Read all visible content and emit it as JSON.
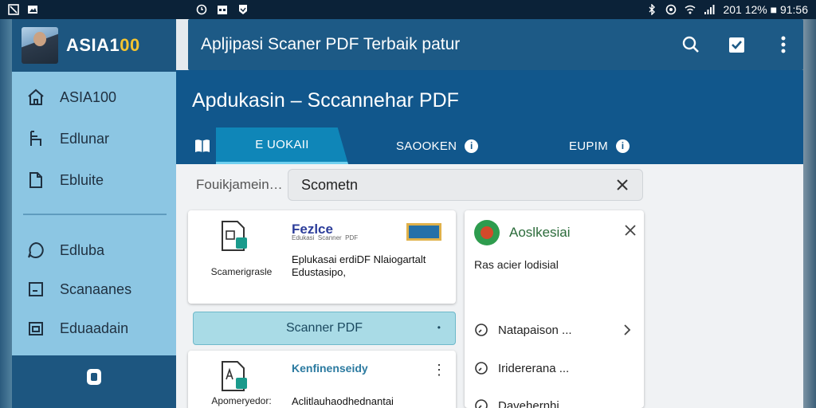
{
  "status_bar": {
    "right_text": "201 12% ■ 91:56"
  },
  "app_bar": {
    "title": "Apljipasi Scaner PDF Terbaik patur"
  },
  "sidebar": {
    "brand_prefix": "ASIA1",
    "brand_accent": "00",
    "items": [
      {
        "label": "ASIA100",
        "icon": "house-icon"
      },
      {
        "label": "Edlunar",
        "icon": "chair-icon"
      },
      {
        "label": "Ebluite",
        "icon": "document-icon"
      },
      {
        "label": "Edluba",
        "icon": "chat-icon"
      },
      {
        "label": "Scanaanes",
        "icon": "scanner-icon"
      },
      {
        "label": "Eduaadain",
        "icon": "image-icon"
      }
    ]
  },
  "header": {
    "title": "Apdukasin – Sccannehar PDF",
    "tabs": [
      {
        "label": "E   UOKAII",
        "active": true
      },
      {
        "label": "SAOOKEN",
        "active": false
      },
      {
        "label": "EUPIM",
        "active": false
      }
    ]
  },
  "filter": {
    "label": "Fouikjamein…",
    "search_value": "Scometn"
  },
  "card1": {
    "doc_label": "Scamerigrasle",
    "brand": "Fezlce",
    "brand_sub": "Edukasi  Scanner  PDF",
    "description": "Eplukasai erdiDF Nlaiogartalt Edustasipo,"
  },
  "scanner_button": {
    "label": "Scanner PDF"
  },
  "card2": {
    "doc_label": "Apomeryedor:",
    "brand": "Kenfinenseidy",
    "description": "Aclitlauhaodhednantai"
  },
  "panel": {
    "title": "Aoslkesiai",
    "subtitle": "Ras acier lodisial",
    "rows": [
      {
        "label": "Natapaison ...",
        "icon": "clock-icon"
      },
      {
        "label": "Iridererana ...",
        "icon": "history-icon"
      },
      {
        "label": "Davehernhi",
        "icon": "time-icon"
      }
    ]
  },
  "colors": {
    "app_bar": "#1d5a86",
    "sidebar": "#8cc6e3",
    "header": "#11578c",
    "active_tab": "#0f86b8",
    "scanner_button": "#a9dbe6"
  }
}
